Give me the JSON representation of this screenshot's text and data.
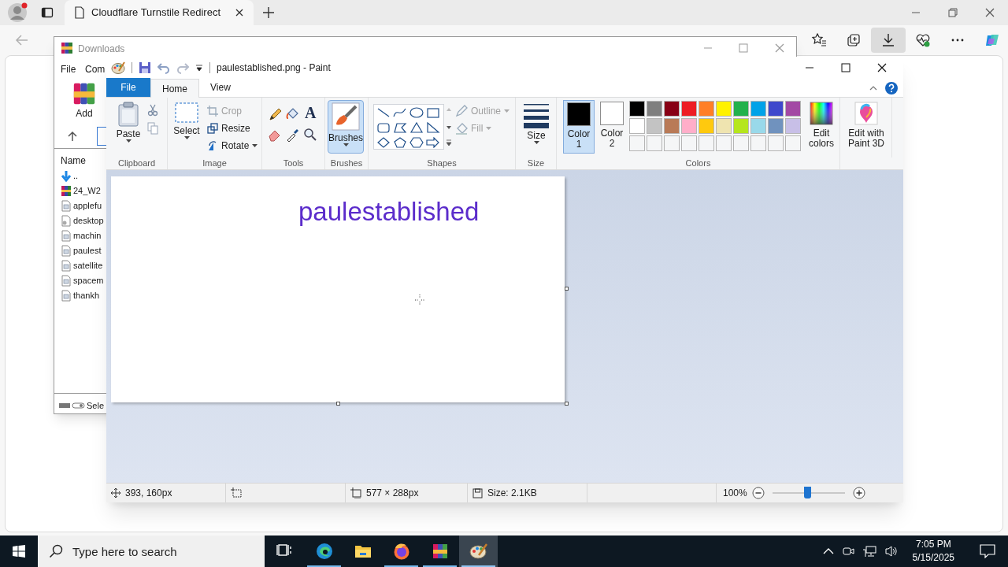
{
  "browser": {
    "tabs": [
      {
        "title": "Cloudflare Turnstile Redirect",
        "selected": true
      }
    ]
  },
  "downloads_window": {
    "title": "Downloads",
    "menu": [
      "File",
      "Com"
    ],
    "add_button": "Add",
    "list_header": "Name",
    "status": "Sele",
    "files": [
      {
        "name": "..",
        "kind": "up"
      },
      {
        "name": "24_W2",
        "kind": "archive"
      },
      {
        "name": "applefu",
        "kind": "image"
      },
      {
        "name": "desktop",
        "kind": "settings"
      },
      {
        "name": "machin",
        "kind": "image"
      },
      {
        "name": "paulest",
        "kind": "image"
      },
      {
        "name": "satellite",
        "kind": "image"
      },
      {
        "name": "spacem",
        "kind": "image"
      },
      {
        "name": "thankh",
        "kind": "image"
      }
    ]
  },
  "paint": {
    "title": "paulestablished.png - Paint",
    "tabs": [
      {
        "label": "File",
        "kind": "file",
        "selected": false
      },
      {
        "label": "Home",
        "kind": "tab",
        "selected": true
      },
      {
        "label": "View",
        "kind": "tab",
        "selected": false
      }
    ],
    "clipboard": {
      "label": "Clipboard",
      "paste": "Paste"
    },
    "image": {
      "label": "Image",
      "select": "Select",
      "crop": {
        "label": "Crop",
        "disabled": true
      },
      "resize": {
        "label": "Resize",
        "disabled": false
      },
      "rotate": {
        "label": "Rotate",
        "disabled": false
      }
    },
    "tools": {
      "label": "Tools",
      "text_glyph": "A"
    },
    "brushes": {
      "button": "Brushes",
      "label": "Brushes",
      "selected": true
    },
    "shapes": {
      "label": "Shapes",
      "outline": {
        "label": "Outline",
        "disabled": true
      },
      "fill": {
        "label": "Fill",
        "disabled": true
      }
    },
    "size": {
      "button": "Size",
      "label": "Size"
    },
    "colors": {
      "label": "Colors",
      "slots": [
        {
          "label": "Color 1",
          "color": "#000000",
          "selected": true
        },
        {
          "label": "Color 2",
          "color": "#ffffff",
          "selected": false
        }
      ],
      "palette": [
        {
          "color": "#000000"
        },
        {
          "color": "#7f7f7f"
        },
        {
          "color": "#880015"
        },
        {
          "color": "#ed1c24"
        },
        {
          "color": "#ff7f27"
        },
        {
          "color": "#fff200"
        },
        {
          "color": "#22b14c"
        },
        {
          "color": "#00a2e8"
        },
        {
          "color": "#3f48cc"
        },
        {
          "color": "#a349a4"
        },
        {
          "color": "#ffffff"
        },
        {
          "color": "#c3c3c3"
        },
        {
          "color": "#b97a57"
        },
        {
          "color": "#ffaec9"
        },
        {
          "color": "#ffc90e"
        },
        {
          "color": "#efe4b0"
        },
        {
          "color": "#b5e61d"
        },
        {
          "color": "#99d9ea"
        },
        {
          "color": "#7092be"
        },
        {
          "color": "#c8bfe7"
        }
      ],
      "edit_colors": "Edit colors"
    },
    "paint3d": "Edit with Paint 3D",
    "canvas": {
      "text": "paulestablished"
    },
    "status": {
      "cursor": "393, 160px",
      "dimensions": "577 × 288px",
      "file_size": "Size: 2.1KB",
      "zoom": "100%",
      "zoom_slider": {
        "level": 0.5
      }
    }
  },
  "taskbar": {
    "search_placeholder": "Type here to search",
    "apps": [
      {
        "kind": "task-view",
        "running": false,
        "selected": false
      },
      {
        "kind": "edge",
        "running": true,
        "selected": false
      },
      {
        "kind": "explorer",
        "running": false,
        "selected": false
      },
      {
        "kind": "firefox",
        "running": true,
        "selected": false
      },
      {
        "kind": "winrar",
        "running": true,
        "selected": false
      },
      {
        "kind": "paint",
        "running": true,
        "selected": true
      }
    ],
    "time": "7:05 PM",
    "date": "5/15/2025"
  }
}
